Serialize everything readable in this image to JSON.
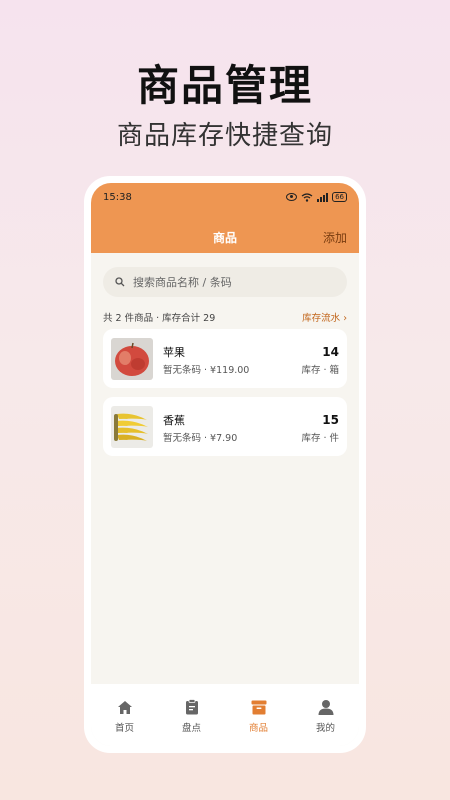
{
  "hero": {
    "title": "商品管理",
    "subtitle": "商品库存快捷查询"
  },
  "status_bar": {
    "time": "15:38",
    "battery": "66"
  },
  "nav": {
    "title": "商品",
    "add_label": "添加"
  },
  "search": {
    "placeholder": "搜索商品名称 / 条码"
  },
  "summary": {
    "text": "共 2 件商品 · 库存合计 29",
    "flow_link": "库存流水 ›"
  },
  "products": [
    {
      "name": "苹果",
      "meta": "暂无条码 · ¥119.00",
      "qty": "14",
      "unit": "库存 · 箱"
    },
    {
      "name": "香蕉",
      "meta": "暂无条码 · ¥7.90",
      "qty": "15",
      "unit": "库存 · 件"
    }
  ],
  "tabs": [
    {
      "label": "首页",
      "icon": "home-icon"
    },
    {
      "label": "盘点",
      "icon": "clipboard-icon"
    },
    {
      "label": "商品",
      "icon": "box-icon"
    },
    {
      "label": "我的",
      "icon": "user-icon"
    }
  ],
  "colors": {
    "accent": "#ee9652",
    "active_tab": "#e27e32",
    "link": "#c2661c"
  }
}
